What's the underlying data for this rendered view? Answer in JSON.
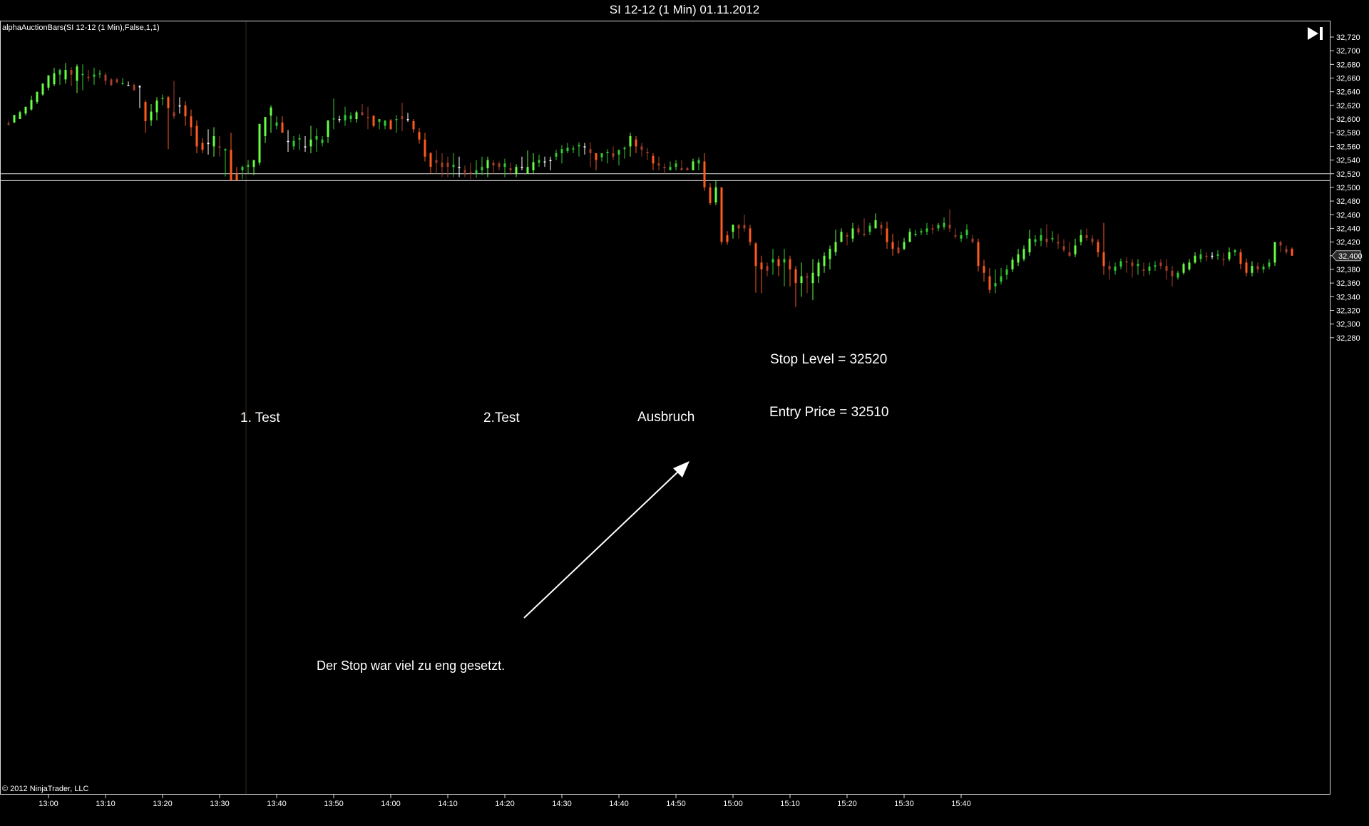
{
  "window": {
    "title": "SI 12-12 (1 Min)  01.11.2012",
    "indicator_label": "alphaAuctionBars(SI 12-12 (1 Min),False,1,1)",
    "copyright": "© 2012 NinjaTrader, LLC"
  },
  "annotations": {
    "stop_level": "Stop Level = 32520",
    "entry_price": "Entry Price = 32510",
    "test1": "1. Test",
    "test2": "2.Test",
    "breakout": "Ausbruch",
    "comment": "Der Stop war viel zu eng gesetzt."
  },
  "colors": {
    "up": "#33cc33",
    "up_strong": "#66ff44",
    "down": "#a8402a",
    "down_strong": "#ff5a1f",
    "neutral": "#ffffff",
    "lines": "#d8d8d8"
  },
  "chart_data": {
    "type": "candlestick",
    "title": "SI 12-12 (1 Min)  01.11.2012",
    "x_ticks": [
      "13:00",
      "13:10",
      "13:20",
      "13:30",
      "13:40",
      "13:50",
      "14:00",
      "14:10",
      "14:20",
      "14:30",
      "14:40",
      "14:50",
      "15:00",
      "15:10",
      "15:20",
      "15:30",
      "15:40"
    ],
    "y_ticks": [
      "32,280",
      "32,300",
      "32,320",
      "32,340",
      "32,360",
      "32,380",
      "32,400",
      "32,420",
      "32,440",
      "32,460",
      "32,480",
      "32,500",
      "32,520",
      "32,540",
      "32,560",
      "32,580",
      "32,600",
      "32,620",
      "32,640",
      "32,660",
      "32,680",
      "32,700",
      "32,720"
    ],
    "ylim": [
      32276,
      32726
    ],
    "start_time": "12:53",
    "interval_minutes": 1,
    "last_price_label": "32,400",
    "horizontal_lines": [
      32520,
      32510
    ],
    "candles": [
      [
        32594,
        32597,
        32592,
        32590
      ],
      [
        32595,
        32606,
        32606,
        32594
      ],
      [
        32600,
        32612,
        32610,
        32600
      ],
      [
        32608,
        32618,
        32618,
        32605
      ],
      [
        32614,
        32634,
        32628,
        32612
      ],
      [
        32625,
        32640,
        32640,
        32622
      ],
      [
        32636,
        32652,
        32652,
        32634
      ],
      [
        32646,
        32664,
        32664,
        32642
      ],
      [
        32651,
        32675,
        32667,
        32648
      ],
      [
        32665,
        32674,
        32672,
        32650
      ],
      [
        32658,
        32682,
        32672,
        32652
      ],
      [
        32672,
        32676,
        32665,
        32648
      ],
      [
        32656,
        32680,
        32677,
        32638
      ],
      [
        32665,
        32680,
        32666,
        32642
      ],
      [
        32662,
        32672,
        32660,
        32655
      ],
      [
        32662,
        32675,
        32665,
        32650
      ],
      [
        32666,
        32672,
        32667,
        32660
      ],
      [
        32665,
        32668,
        32656,
        32650
      ],
      [
        32658,
        32660,
        32650,
        32648
      ],
      [
        32658,
        32660,
        32654,
        32652
      ],
      [
        32652,
        32660,
        32653,
        32650
      ],
      [
        32650,
        32655,
        32650,
        32650
      ],
      [
        32650,
        32652,
        32642,
        32642
      ],
      [
        32648,
        32650,
        32648,
        32616
      ],
      [
        32625,
        32628,
        32597,
        32580
      ],
      [
        32598,
        32622,
        32611,
        32590
      ],
      [
        32610,
        32632,
        32627,
        32598
      ],
      [
        32630,
        32636,
        32631,
        32620
      ],
      [
        32632,
        32634,
        32616,
        32556
      ],
      [
        32610,
        32656,
        32604,
        32600
      ],
      [
        32620,
        32632,
        32620,
        32608
      ],
      [
        32620,
        32626,
        32604,
        32590
      ],
      [
        32604,
        32614,
        32588,
        32575
      ],
      [
        32590,
        32598,
        32560,
        32550
      ],
      [
        32565,
        32572,
        32555,
        32550
      ],
      [
        32565,
        32585,
        32565,
        32548
      ],
      [
        32560,
        32588,
        32575,
        32545
      ],
      [
        32560,
        32575,
        32558,
        32545
      ],
      [
        32554,
        32557,
        32556,
        32516
      ],
      [
        32555,
        32580,
        32510,
        32510
      ],
      [
        32520,
        32530,
        32510,
        32512
      ],
      [
        32525,
        32532,
        32530,
        32512
      ],
      [
        32530,
        32540,
        32533,
        32520
      ],
      [
        32530,
        32540,
        32540,
        32518
      ],
      [
        32536,
        32586,
        32593,
        32532
      ],
      [
        32575,
        32600,
        32603,
        32565
      ],
      [
        32605,
        32620,
        32617,
        32580
      ],
      [
        32590,
        32604,
        32595,
        32585
      ],
      [
        32595,
        32604,
        32580,
        32590
      ],
      [
        32568,
        32584,
        32568,
        32552
      ],
      [
        32560,
        32575,
        32568,
        32555
      ],
      [
        32570,
        32578,
        32572,
        32555
      ],
      [
        32560,
        32575,
        32560,
        32552
      ],
      [
        32560,
        32590,
        32570,
        32550
      ],
      [
        32570,
        32586,
        32575,
        32552
      ],
      [
        32565,
        32575,
        32570,
        32560
      ],
      [
        32574,
        32598,
        32598,
        32565
      ],
      [
        32600,
        32630,
        32601,
        32585
      ],
      [
        32600,
        32605,
        32600,
        32595
      ],
      [
        32598,
        32618,
        32606,
        32590
      ],
      [
        32600,
        32610,
        32605,
        32595
      ],
      [
        32600,
        32612,
        32610,
        32595
      ],
      [
        32610,
        32622,
        32606,
        32605
      ],
      [
        32603,
        32618,
        32602,
        32585
      ],
      [
        32605,
        32596,
        32590,
        32588
      ],
      [
        32596,
        32600,
        32600,
        32585
      ],
      [
        32590,
        32598,
        32598,
        32585
      ],
      [
        32598,
        32600,
        32585,
        32585
      ],
      [
        32599,
        32606,
        32600,
        32580
      ],
      [
        32604,
        32624,
        32600,
        32582
      ],
      [
        32600,
        32609,
        32600,
        32596
      ],
      [
        32597,
        32600,
        32585,
        32580
      ],
      [
        32581,
        32587,
        32570,
        32564
      ],
      [
        32570,
        32580,
        32545,
        32538
      ],
      [
        32550,
        32552,
        32530,
        32520
      ],
      [
        32540,
        32555,
        32536,
        32520
      ],
      [
        32536,
        32550,
        32530,
        32515
      ],
      [
        32536,
        32545,
        32530,
        32515
      ],
      [
        32530,
        32550,
        32533,
        32515
      ],
      [
        32530,
        32545,
        32530,
        32515
      ],
      [
        32525,
        32532,
        32522,
        32515
      ],
      [
        32522,
        32536,
        32520,
        32512
      ],
      [
        32520,
        32540,
        32525,
        32514
      ],
      [
        32525,
        32545,
        32530,
        32518
      ],
      [
        32528,
        32545,
        32540,
        32515
      ],
      [
        32536,
        32540,
        32532,
        32520
      ],
      [
        32535,
        32538,
        32530,
        32525
      ],
      [
        32530,
        32542,
        32535,
        32515
      ],
      [
        32528,
        32536,
        32525,
        32518
      ],
      [
        32520,
        32534,
        32530,
        32515
      ],
      [
        32530,
        32545,
        32530,
        32525
      ],
      [
        32520,
        32554,
        32530,
        32520
      ],
      [
        32525,
        32550,
        32537,
        32520
      ],
      [
        32536,
        32548,
        32540,
        32530
      ],
      [
        32538,
        32545,
        32538,
        32530
      ],
      [
        32540,
        32545,
        32540,
        32525
      ],
      [
        32545,
        32555,
        32550,
        32540
      ],
      [
        32550,
        32562,
        32556,
        32535
      ],
      [
        32553,
        32565,
        32558,
        32550
      ],
      [
        32556,
        32561,
        32557,
        32550
      ],
      [
        32560,
        32566,
        32562,
        32545
      ],
      [
        32560,
        32565,
        32560,
        32548
      ],
      [
        32556,
        32566,
        32550,
        32530
      ],
      [
        32550,
        32550,
        32540,
        32525
      ],
      [
        32544,
        32550,
        32550,
        32538
      ],
      [
        32550,
        32556,
        32552,
        32535
      ],
      [
        32550,
        32560,
        32545,
        32540
      ],
      [
        32548,
        32555,
        32555,
        32532
      ],
      [
        32556,
        32560,
        32558,
        32542
      ],
      [
        32560,
        32580,
        32575,
        32545
      ],
      [
        32570,
        32575,
        32560,
        32550
      ],
      [
        32560,
        32565,
        32555,
        32545
      ],
      [
        32552,
        32558,
        32550,
        32540
      ],
      [
        32546,
        32550,
        32535,
        32525
      ],
      [
        32535,
        32545,
        32532,
        32525
      ],
      [
        32530,
        32535,
        32528,
        32520
      ],
      [
        32525,
        32538,
        32530,
        32525
      ],
      [
        32530,
        32540,
        32535,
        32525
      ],
      [
        32528,
        32540,
        32525,
        32525
      ],
      [
        32528,
        32530,
        32525,
        32525
      ],
      [
        32525,
        32542,
        32538,
        32525
      ],
      [
        32535,
        32544,
        32540,
        32525
      ],
      [
        32538,
        32550,
        32500,
        32495
      ],
      [
        32500,
        32506,
        32477,
        32474
      ],
      [
        32478,
        32510,
        32500,
        32474
      ],
      [
        32500,
        32500,
        32420,
        32416
      ],
      [
        32430,
        32436,
        32420,
        32416
      ],
      [
        32435,
        32446,
        32445,
        32425
      ],
      [
        32445,
        32446,
        32440,
        32425
      ],
      [
        32445,
        32460,
        32440,
        32435
      ],
      [
        32440,
        32445,
        32420,
        32415
      ],
      [
        32418,
        32420,
        32385,
        32346
      ],
      [
        32390,
        32400,
        32380,
        32345
      ],
      [
        32385,
        32390,
        32378,
        32370
      ],
      [
        32390,
        32410,
        32395,
        32372
      ],
      [
        32395,
        32400,
        32385,
        32370
      ],
      [
        32390,
        32410,
        32395,
        32355
      ],
      [
        32395,
        32400,
        32380,
        32355
      ],
      [
        32380,
        32385,
        32360,
        32325
      ],
      [
        32360,
        32390,
        32370,
        32340
      ],
      [
        32370,
        32375,
        32368,
        32345
      ],
      [
        32360,
        32395,
        32375,
        32335
      ],
      [
        32370,
        32395,
        32390,
        32360
      ],
      [
        32385,
        32405,
        32400,
        32375
      ],
      [
        32395,
        32415,
        32410,
        32380
      ],
      [
        32405,
        32438,
        32420,
        32400
      ],
      [
        32420,
        32440,
        32435,
        32420
      ],
      [
        32430,
        32434,
        32428,
        32415
      ],
      [
        32425,
        32448,
        32440,
        32420
      ],
      [
        32440,
        32445,
        32434,
        32430
      ],
      [
        32432,
        32455,
        32430,
        32428
      ],
      [
        32435,
        32448,
        32444,
        32430
      ],
      [
        32440,
        32462,
        32452,
        32440
      ],
      [
        32445,
        32450,
        32440,
        32430
      ],
      [
        32440,
        32450,
        32420,
        32410
      ],
      [
        32420,
        32432,
        32410,
        32400
      ],
      [
        32412,
        32422,
        32404,
        32402
      ],
      [
        32410,
        32426,
        32420,
        32408
      ],
      [
        32420,
        32440,
        32435,
        32425
      ],
      [
        32430,
        32438,
        32432,
        32428
      ],
      [
        32434,
        32440,
        32436,
        32430
      ],
      [
        32435,
        32448,
        32440,
        32430
      ],
      [
        32440,
        32446,
        32438,
        32432
      ],
      [
        32440,
        32448,
        32445,
        32436
      ],
      [
        32442,
        32456,
        32448,
        32438
      ],
      [
        32445,
        32468,
        32440,
        32435
      ],
      [
        32430,
        32440,
        32428,
        32425
      ],
      [
        32425,
        32435,
        32430,
        32420
      ],
      [
        32430,
        32446,
        32438,
        32425
      ],
      [
        32425,
        32430,
        32420,
        32418
      ],
      [
        32420,
        32425,
        32385,
        32377
      ],
      [
        32385,
        32394,
        32375,
        32362
      ],
      [
        32370,
        32382,
        32350,
        32345
      ],
      [
        32355,
        32380,
        32360,
        32345
      ],
      [
        32362,
        32382,
        32370,
        32358
      ],
      [
        32372,
        32386,
        32380,
        32365
      ],
      [
        32380,
        32398,
        32394,
        32376
      ],
      [
        32390,
        32410,
        32402,
        32385
      ],
      [
        32395,
        32415,
        32410,
        32392
      ],
      [
        32405,
        32438,
        32425,
        32400
      ],
      [
        32420,
        32430,
        32424,
        32414
      ],
      [
        32422,
        32440,
        32430,
        32414
      ],
      [
        32425,
        32446,
        32420,
        32412
      ],
      [
        32424,
        32436,
        32426,
        32420
      ],
      [
        32420,
        32432,
        32418,
        32410
      ],
      [
        32414,
        32424,
        32408,
        32405
      ],
      [
        32405,
        32420,
        32400,
        32398
      ],
      [
        32402,
        32425,
        32415,
        32398
      ],
      [
        32420,
        32438,
        32430,
        32415
      ],
      [
        32430,
        32440,
        32426,
        32422
      ],
      [
        32425,
        32430,
        32420,
        32415
      ],
      [
        32420,
        32424,
        32405,
        32398
      ],
      [
        32405,
        32448,
        32385,
        32372
      ],
      [
        32385,
        32392,
        32380,
        32365
      ],
      [
        32378,
        32390,
        32384,
        32372
      ],
      [
        32384,
        32396,
        32392,
        32380
      ],
      [
        32392,
        32398,
        32390,
        32375
      ],
      [
        32390,
        32395,
        32385,
        32368
      ],
      [
        32385,
        32395,
        32388,
        32372
      ],
      [
        32380,
        32390,
        32378,
        32370
      ],
      [
        32378,
        32390,
        32384,
        32372
      ],
      [
        32384,
        32392,
        32386,
        32378
      ],
      [
        32390,
        32395,
        32385,
        32380
      ],
      [
        32385,
        32395,
        32378,
        32365
      ],
      [
        32378,
        32385,
        32370,
        32355
      ],
      [
        32368,
        32378,
        32375,
        32365
      ],
      [
        32375,
        32390,
        32388,
        32372
      ],
      [
        32380,
        32395,
        32390,
        32378
      ],
      [
        32390,
        32405,
        32400,
        32388
      ],
      [
        32395,
        32410,
        32402,
        32390
      ],
      [
        32400,
        32405,
        32398,
        32392
      ],
      [
        32400,
        32405,
        32400,
        32395
      ],
      [
        32400,
        32408,
        32402,
        32394
      ],
      [
        32395,
        32404,
        32394,
        32385
      ],
      [
        32395,
        32412,
        32405,
        32392
      ],
      [
        32405,
        32410,
        32408,
        32400
      ],
      [
        32405,
        32410,
        32388,
        32380
      ],
      [
        32390,
        32396,
        32375,
        32370
      ],
      [
        32375,
        32392,
        32385,
        32370
      ],
      [
        32385,
        32390,
        32380,
        32375
      ],
      [
        32380,
        32388,
        32384,
        32375
      ],
      [
        32384,
        32395,
        32390,
        32380
      ],
      [
        32390,
        32420,
        32420,
        32385
      ],
      [
        32420,
        32422,
        32415,
        32405
      ],
      [
        32410,
        32415,
        32405,
        32402
      ],
      [
        32410,
        32412,
        32400,
        32400
      ]
    ]
  }
}
